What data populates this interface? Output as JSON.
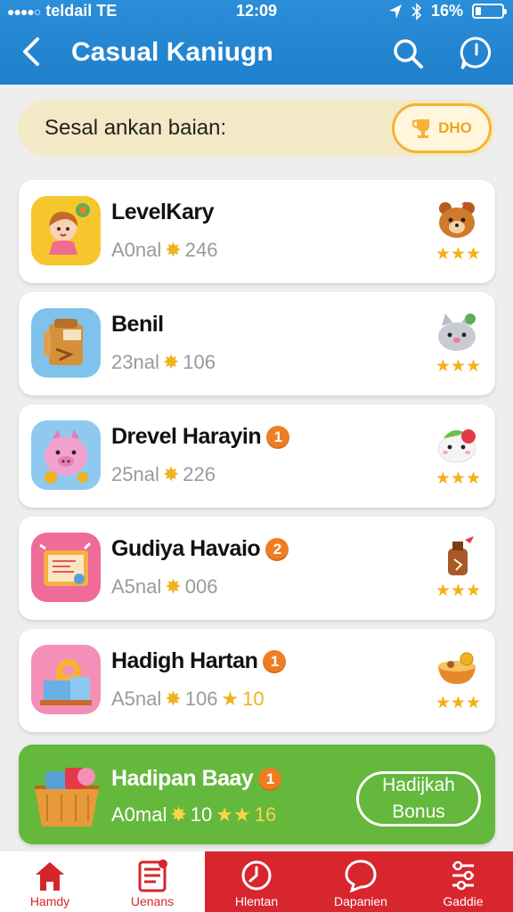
{
  "status": {
    "carrier": "teldail TE",
    "time": "12:09",
    "battery": "16%"
  },
  "header": {
    "title": "Casual Kaniugn"
  },
  "banner": {
    "text": "Sesal ankan baian:",
    "button": "DHO"
  },
  "items": [
    {
      "title": "LevelKary",
      "badge": "",
      "prefix": "A0nal",
      "value": "246",
      "extra": "",
      "thumb_color": "#f6c72c",
      "stars": "★★★"
    },
    {
      "title": "Benil",
      "badge": "",
      "prefix": "23nal",
      "value": "106",
      "extra": "",
      "thumb_color": "#7fc3ec",
      "stars": "★★★"
    },
    {
      "title": "Drevel Harayin",
      "badge": "1",
      "prefix": "25nal",
      "value": "226",
      "extra": "",
      "thumb_color": "#8fc9ef",
      "stars": "★★★"
    },
    {
      "title": "Gudiya Havaio",
      "badge": "2",
      "prefix": "A5nal",
      "value": "006",
      "extra": "",
      "thumb_color": "#ee6b9a",
      "stars": "★★★"
    },
    {
      "title": "Hadigh Hartan",
      "badge": "1",
      "prefix": "A5nal",
      "value": "106",
      "extra": "10",
      "thumb_color": "#f48fb8",
      "stars": "★★★"
    }
  ],
  "bonus": {
    "title": "Hadipan Baay",
    "badge": "1",
    "prefix": "A0mal",
    "value": "10",
    "extra": "16",
    "button_line1": "Hadijkah",
    "button_line2": "Bonus"
  },
  "tabs": [
    {
      "label": "Hamdy",
      "icon": "home-icon"
    },
    {
      "label": "Uenans",
      "icon": "list-icon"
    },
    {
      "label": "Hlentan",
      "icon": "clock-icon"
    },
    {
      "label": "Dapanien",
      "icon": "chat-icon"
    },
    {
      "label": "Gaddie",
      "icon": "settings-icon"
    }
  ],
  "colors": {
    "header": "#1f7fcc",
    "accent_orange": "#ef7d22",
    "star": "#f5b017",
    "bonus_green": "#64b83c",
    "tab_red": "#d8262e"
  }
}
